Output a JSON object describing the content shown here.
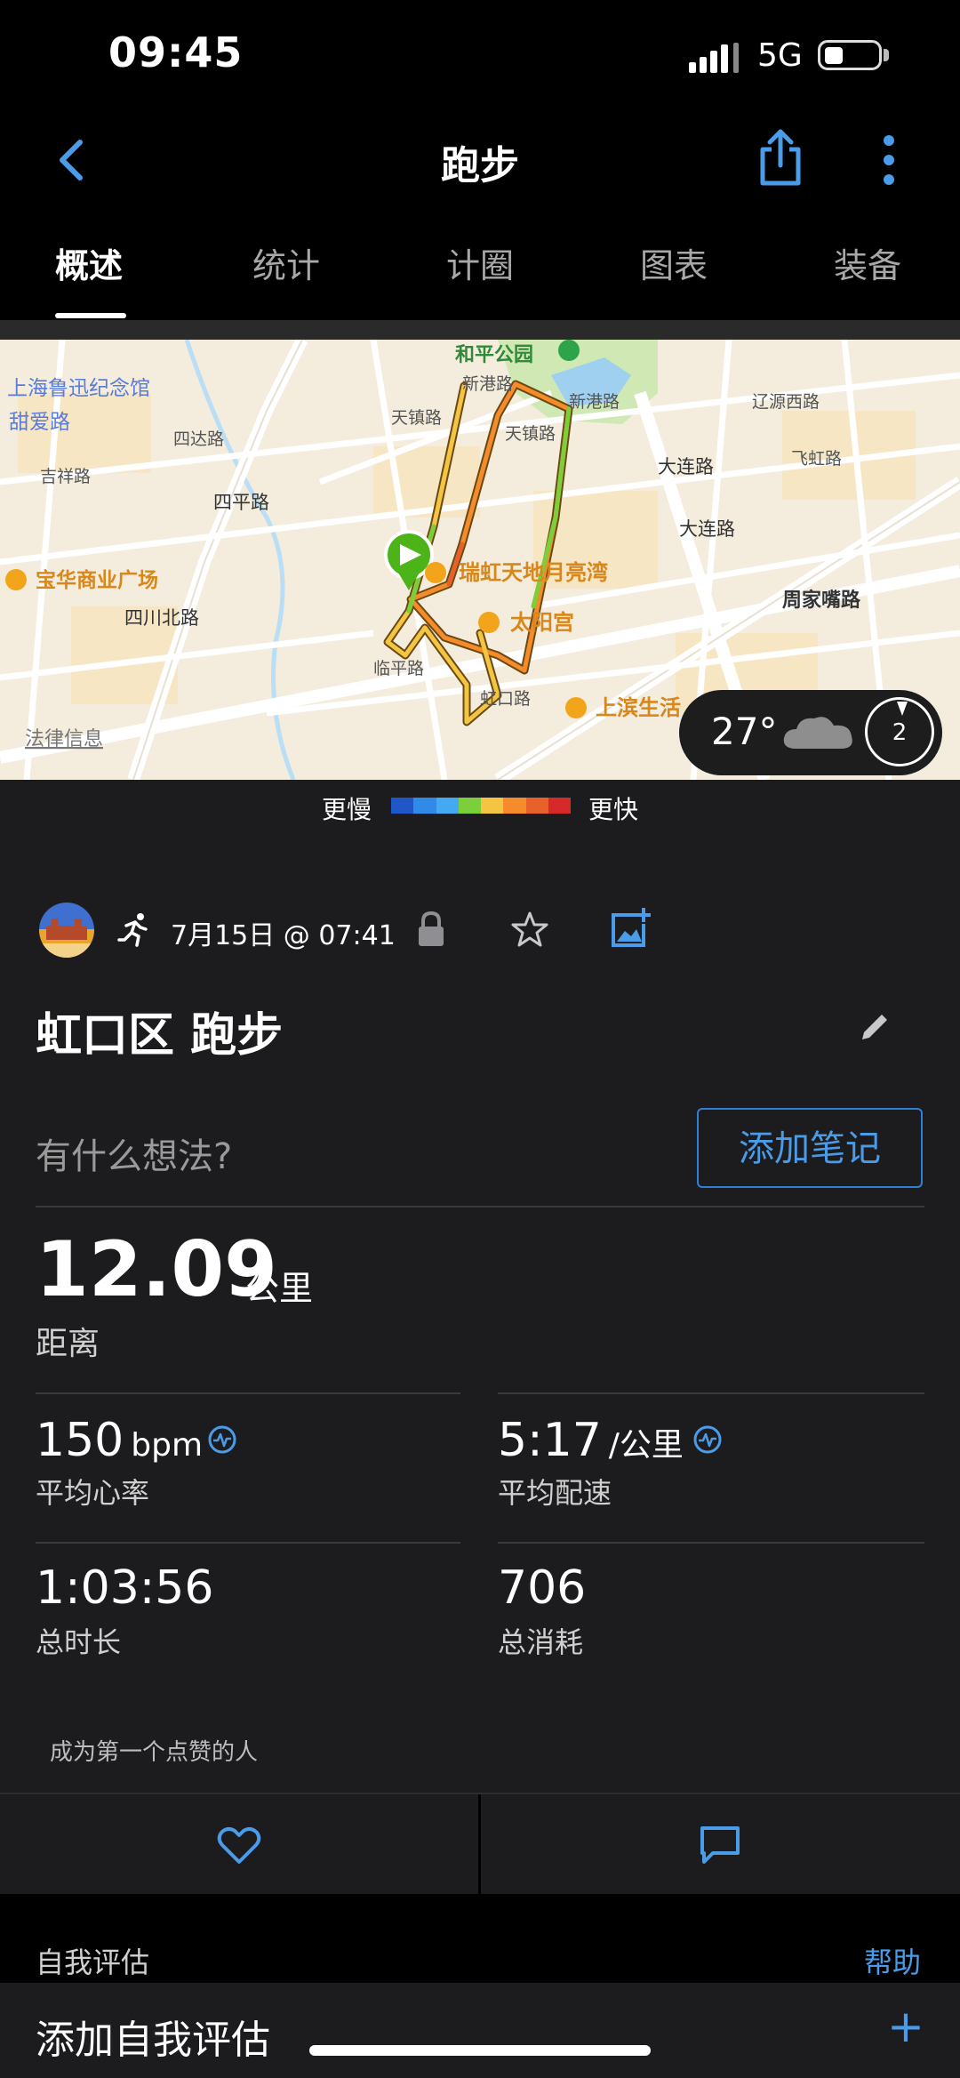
{
  "status": {
    "time": "09:45",
    "network": "5G"
  },
  "nav": {
    "title": "跑步",
    "back_icon": "chevron-left-icon",
    "share_icon": "share-icon",
    "more_icon": "more-vertical-icon"
  },
  "tabs": [
    {
      "label": "概述",
      "active": true
    },
    {
      "label": "统计",
      "active": false
    },
    {
      "label": "计圈",
      "active": false
    },
    {
      "label": "图表",
      "active": false
    },
    {
      "label": "装备",
      "active": false
    }
  ],
  "map": {
    "labels": {
      "park": "和平公园",
      "luxun": "上海鲁迅纪念馆",
      "tianai": "甜爱路",
      "sichuan_n": "四川北路",
      "sichuan_n2": "四平路",
      "xingang": "新港路",
      "xingang2": "新港路",
      "tianzhen": "天镇路",
      "tianzhen2": "天镇路",
      "liaoyuan": "辽源西路",
      "feihong": "飞虹路",
      "dalian": "大连路",
      "dalian2": "大连路",
      "sida": "四达路",
      "jixiang": "吉祥路",
      "baohua": "宝华商业广场",
      "ruihong": "瑞虹天地月亮湾",
      "taiyang": "太阳宫",
      "zhoujiazui": "周家嘴路",
      "shangbin": "上滨生活",
      "legal": "法律信息",
      "linping": "临平路",
      "hongkou": "虹口路"
    },
    "weather": {
      "temp": "27°",
      "icon": "cloud-icon",
      "dial": "2"
    }
  },
  "legend": {
    "slow": "更慢",
    "fast": "更快",
    "colors": [
      "#1f57c9",
      "#2f8ae8",
      "#43a9f0",
      "#7ccf3a",
      "#f4c542",
      "#f58b2b",
      "#e8612a",
      "#d62a2a"
    ]
  },
  "activity": {
    "date": "7月15日 @ 07:41",
    "title": "虹口区 跑步",
    "note_prompt": "有什么想法?",
    "note_button": "添加笔记",
    "distance": {
      "value": "12.09",
      "unit": "公里",
      "label": "距离"
    },
    "stats": [
      {
        "value": "150",
        "unit": "bpm",
        "label": "平均心率"
      },
      {
        "value": "5:17",
        "unit": "/公里",
        "label": "平均配速"
      },
      {
        "value": "1:03:56",
        "unit": "",
        "label": "总时长"
      },
      {
        "value": "706",
        "unit": "",
        "label": "总消耗"
      }
    ],
    "kudos": "成为第一个点赞的人"
  },
  "self_eval": {
    "title": "自我评估",
    "help": "帮助",
    "add_label": "添加自我评估",
    "add_icon": "+"
  }
}
